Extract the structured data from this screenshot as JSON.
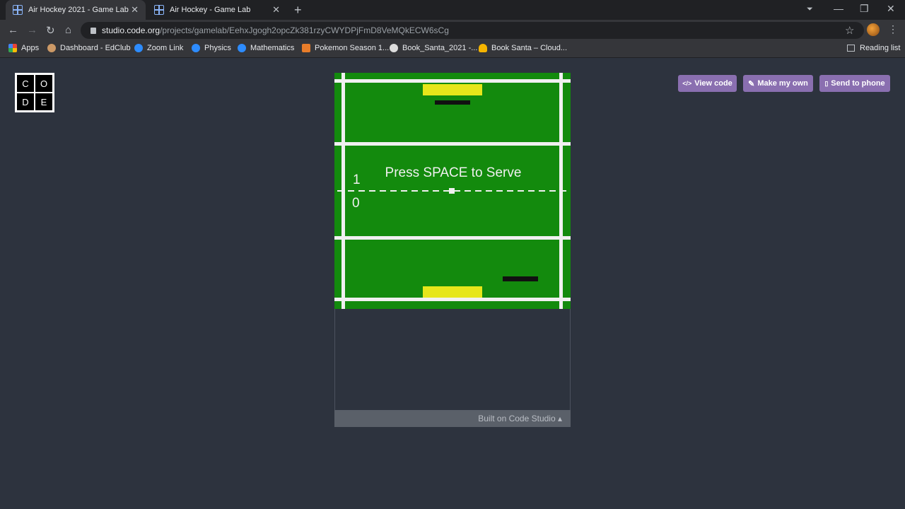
{
  "browser": {
    "tabs": [
      {
        "title": "Air Hockey 2021 - Game Lab",
        "active": true
      },
      {
        "title": "Air Hockey - Game Lab",
        "active": false
      }
    ],
    "url_host": "studio.code.org",
    "url_path": "/projects/gamelab/EehxJgogh2opcZk381rzyCWYDPjFmD8VeMQkECW6sCg",
    "bookmarks": [
      "Apps",
      "Dashboard - EdClub",
      "Zoom Link",
      "Physics",
      "Mathematics",
      "Pokemon Season 1...",
      "Book_Santa_2021 -...",
      "Book Santa – Cloud..."
    ],
    "reading_list": "Reading list"
  },
  "logo": {
    "letters": [
      "C",
      "O",
      "D",
      "E"
    ]
  },
  "actions": {
    "view_code": "View code",
    "make_my_own": "Make my own",
    "send_to_phone": "Send to phone"
  },
  "game": {
    "message": "Press SPACE to Serve",
    "score_top": "1",
    "score_bottom": "0",
    "colors": {
      "field": "#138a0d",
      "lines": "#f0f0f0",
      "paddle": "#e6e61a",
      "blocker": "#111111"
    }
  },
  "footer": {
    "label": "Built on Code Studio ▴"
  }
}
